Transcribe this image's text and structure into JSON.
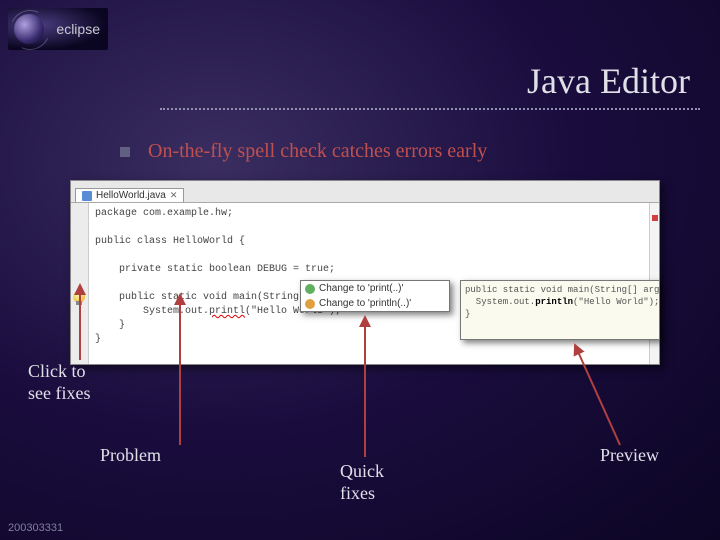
{
  "brand": "eclipse",
  "title": "Java Editor",
  "bullet": "On-the-fly spell check catches errors early",
  "editor": {
    "tab_name": "HelloWorld.java",
    "code_lines": [
      "package com.example.hw;",
      "",
      "public class HelloWorld {",
      "",
      "    private static boolean DEBUG = true;",
      "",
      "    public static void main(String[] args) {",
      "        System.out.printl(\"Hello World\");",
      "    }",
      "}"
    ],
    "error_token": "printl"
  },
  "quickfix": {
    "items": [
      {
        "label": "Change to 'print(..)'"
      },
      {
        "label": "Change to 'println(..)'"
      }
    ]
  },
  "preview": {
    "lines": [
      "public static void main(String[] args){",
      "  System.out.println(\"Hello World\");",
      "}"
    ],
    "highlight": "println"
  },
  "callouts": {
    "click_to_see_fixes": "Click to see fixes",
    "problem": "Problem",
    "quick_fixes": "Quick fixes",
    "preview": "Preview"
  },
  "footer": "200303331",
  "colors": {
    "accent_text": "#c05050",
    "arrow": "#b04040"
  }
}
